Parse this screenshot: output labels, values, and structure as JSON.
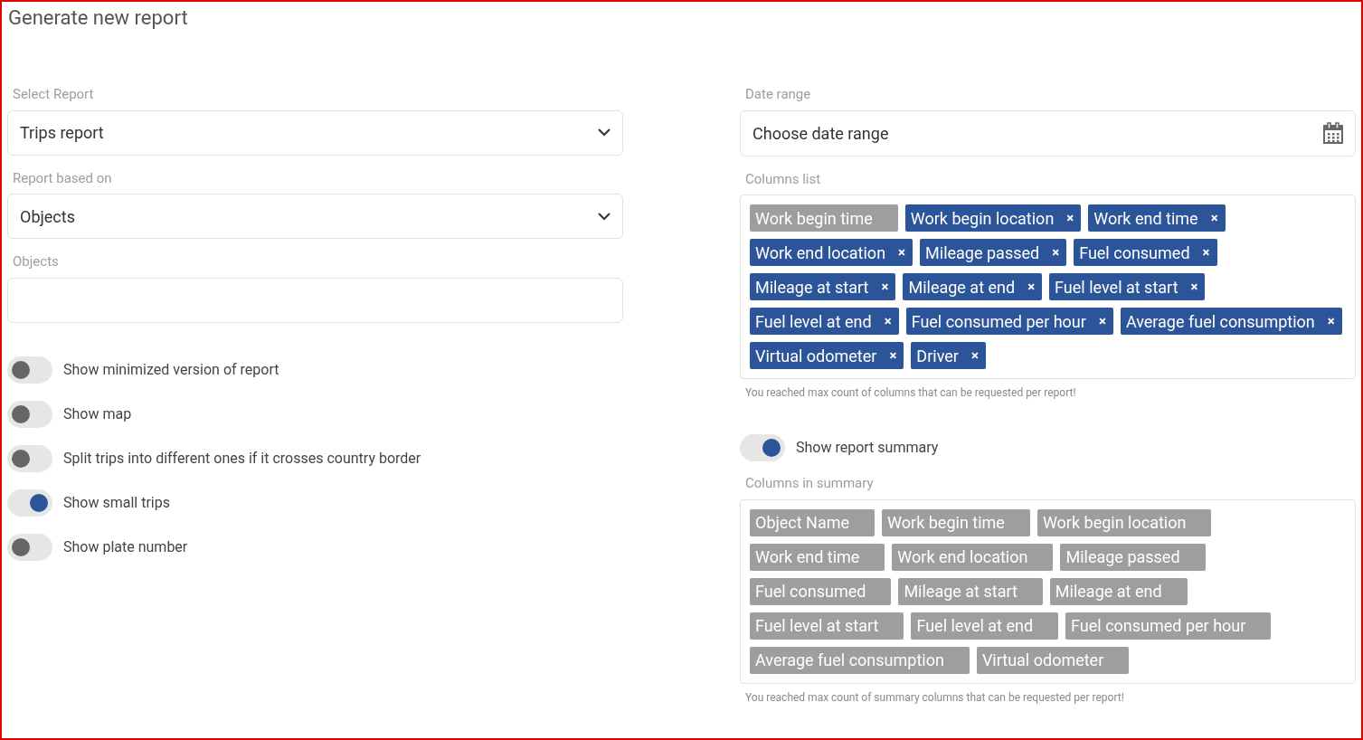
{
  "title": "Generate new report",
  "left": {
    "select_report": {
      "label": "Select Report",
      "value": "Trips report"
    },
    "report_based_on": {
      "label": "Report based on",
      "value": "Objects"
    },
    "objects": {
      "label": "Objects"
    },
    "toggles": [
      {
        "label": "Show minimized version of report",
        "on": false
      },
      {
        "label": "Show map",
        "on": false
      },
      {
        "label": "Split trips into different ones if it crosses country border",
        "on": false
      },
      {
        "label": "Show small trips",
        "on": true
      },
      {
        "label": "Show plate number",
        "on": false
      }
    ]
  },
  "right": {
    "date_range": {
      "label": "Date range",
      "placeholder": "Choose date range"
    },
    "columns_list": {
      "label": "Columns list",
      "tags": [
        {
          "label": "Work begin time",
          "removable": false
        },
        {
          "label": "Work begin location",
          "removable": true,
          "remove": "×"
        },
        {
          "label": "Work end time",
          "removable": true,
          "remove": "×"
        },
        {
          "label": "Work end location",
          "removable": true,
          "remove": "×"
        },
        {
          "label": "Mileage passed",
          "removable": true,
          "remove": "×"
        },
        {
          "label": "Fuel consumed",
          "removable": true,
          "remove": "×"
        },
        {
          "label": "Mileage at start",
          "removable": true,
          "remove": "×"
        },
        {
          "label": "Mileage at end",
          "removable": true,
          "remove": "×"
        },
        {
          "label": "Fuel level at start",
          "removable": true,
          "remove": "×"
        },
        {
          "label": "Fuel level at end",
          "removable": true,
          "remove": "×"
        },
        {
          "label": "Fuel consumed per hour",
          "removable": true,
          "remove": "×"
        },
        {
          "label": "Average fuel consumption",
          "removable": true,
          "remove": "×"
        },
        {
          "label": "Virtual odometer",
          "removable": true,
          "remove": "×"
        },
        {
          "label": "Driver",
          "removable": true,
          "remove": "×"
        }
      ],
      "hint": "You reached max count of columns that can be requested per report!"
    },
    "summary_toggle": {
      "label": "Show report summary",
      "on": true
    },
    "columns_in_summary": {
      "label": "Columns in summary",
      "tags": [
        {
          "label": "Object Name",
          "removable": false
        },
        {
          "label": "Work begin time",
          "removable": false
        },
        {
          "label": "Work begin location",
          "removable": false
        },
        {
          "label": "Work end time",
          "removable": false
        },
        {
          "label": "Work end location",
          "removable": false
        },
        {
          "label": "Mileage passed",
          "removable": false
        },
        {
          "label": "Fuel consumed",
          "removable": false
        },
        {
          "label": "Mileage at start",
          "removable": false
        },
        {
          "label": "Mileage at end",
          "removable": false
        },
        {
          "label": "Fuel level at start",
          "removable": false
        },
        {
          "label": "Fuel level at end",
          "removable": false
        },
        {
          "label": "Fuel consumed per hour",
          "removable": false
        },
        {
          "label": "Average fuel consumption",
          "removable": false
        },
        {
          "label": "Virtual odometer",
          "removable": false
        }
      ],
      "hint": "You reached max count of summary columns that can be requested per report!"
    }
  }
}
